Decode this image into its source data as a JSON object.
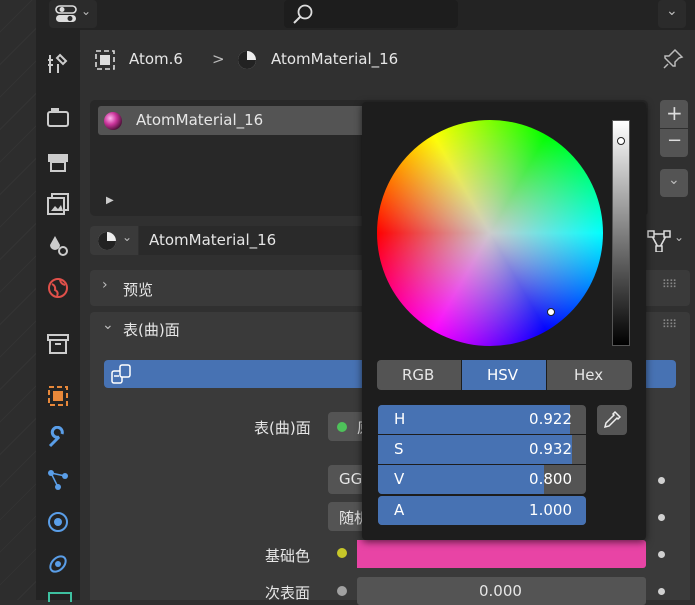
{
  "header": {
    "object_name": "Atom.6",
    "material_name": "AtomMaterial_16",
    "separator": ">"
  },
  "material_slots": {
    "selected": "AtomMaterial_16",
    "add": "+",
    "remove": "−"
  },
  "material_selector": {
    "name": "AtomMaterial_16"
  },
  "panels": {
    "preview": "预览",
    "surface": "表(曲)面"
  },
  "properties": {
    "surface_label": "表(曲)面",
    "surface_value_trunc": "原",
    "ggx_trunc": "GG",
    "random_trunc": "随机",
    "base_color_label": "基础色",
    "base_color_hex": "#e844a5",
    "subsurface_label": "次表面",
    "subsurface_value": "0.000"
  },
  "color_picker": {
    "modes": [
      "RGB",
      "HSV",
      "Hex"
    ],
    "active_mode": "HSV",
    "fields": [
      {
        "label": "H",
        "value": "0.922",
        "fraction": 0.922
      },
      {
        "label": "S",
        "value": "0.932",
        "fraction": 0.932
      },
      {
        "label": "V",
        "value": "0.800",
        "fraction": 0.8
      },
      {
        "label": "A",
        "value": "1.000",
        "fraction": 1.0
      }
    ]
  },
  "colors": {
    "accent": "#4772b3",
    "base_color": "#e844a5",
    "panel_bg": "#303030",
    "popup_bg": "#1d1d1d"
  }
}
